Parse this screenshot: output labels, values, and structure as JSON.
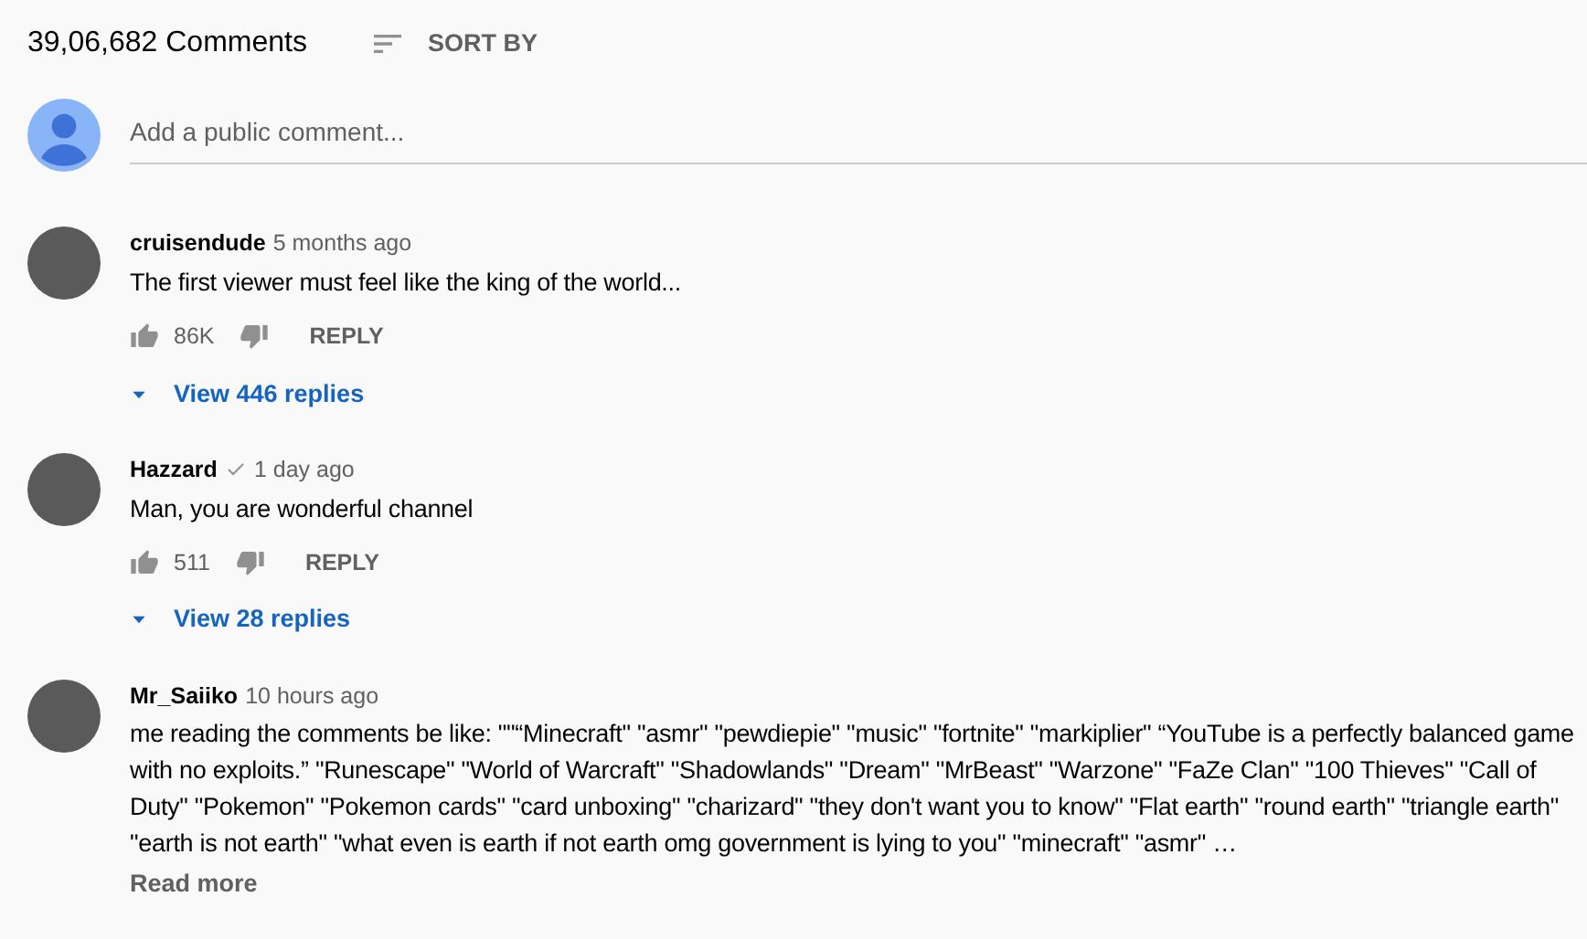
{
  "header": {
    "count": "39,06,682 Comments",
    "sort_label": "SORT BY"
  },
  "composer": {
    "placeholder": "Add a public comment..."
  },
  "comments": [
    {
      "author": "cruisendude",
      "verified": false,
      "time": "5 months ago",
      "text": "The first viewer must feel like the king of the world...",
      "likes": "86K",
      "reply": "REPLY",
      "replies": "View 446 replies"
    },
    {
      "author": "Hazzard",
      "verified": true,
      "time": "1 day ago",
      "text": "Man, you are wonderful channel",
      "likes": "511",
      "reply": "REPLY",
      "replies": "View 28 replies"
    },
    {
      "author": "Mr_Saiiko",
      "verified": false,
      "time": "10 hours ago",
      "text": "me reading the comments be like: \"\"“Minecraft\" \"asmr\" \"pewdiepie\" \"music\" \"fortnite\" \"markiplier\" “YouTube is a perfectly balanced game with no exploits.” \"Runescape\" \"World of Warcraft\" \"Shadowlands\" \"Dream\" \"MrBeast\" \"Warzone\" \"FaZe Clan\" \"100 Thieves\" \"Call of Duty\" \"Pokemon\" \"Pokemon cards\" \"card unboxing\" \"charizard\" \"they don't want you to know\" \"Flat earth\" \"round earth\" \"triangle earth\" \"earth is not earth\" \"what even is earth if not earth omg government is lying to you\" \"minecraft\" \"asmr\" …",
      "read_more": "Read more"
    }
  ]
}
